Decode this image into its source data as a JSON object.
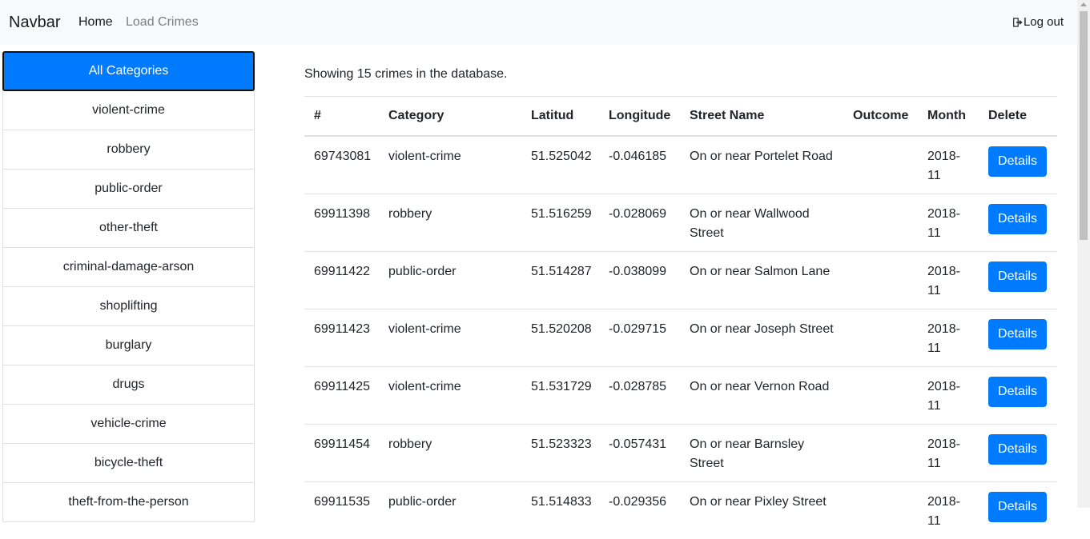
{
  "navbar": {
    "brand": "Navbar",
    "links": [
      "Home",
      "Load Crimes"
    ],
    "logout_label": "Log out",
    "logout_icon": "sign-out-icon"
  },
  "sidebar": {
    "categories": [
      "All Categories",
      "violent-crime",
      "robbery",
      "public-order",
      "other-theft",
      "criminal-damage-arson",
      "shoplifting",
      "burglary",
      "drugs",
      "vehicle-crime",
      "bicycle-theft",
      "theft-from-the-person"
    ],
    "active_index": 0
  },
  "main": {
    "summary": "Showing 15 crimes in the database.",
    "table": {
      "headers": [
        "#",
        "Category",
        "Latitud",
        "Longitude",
        "Street Name",
        "Outcome",
        "Month",
        "Delete"
      ],
      "rows": [
        [
          "69743081",
          "violent-crime",
          "51.525042",
          "-0.046185",
          "On or near Portelet Road",
          "",
          "2018-11"
        ],
        [
          "69911398",
          "robbery",
          "51.516259",
          "-0.028069",
          "On or near Wallwood Street",
          "",
          "2018-11"
        ],
        [
          "69911422",
          "public-order",
          "51.514287",
          "-0.038099",
          "On or near Salmon Lane",
          "",
          "2018-11"
        ],
        [
          "69911423",
          "violent-crime",
          "51.520208",
          "-0.029715",
          "On or near Joseph Street",
          "",
          "2018-11"
        ],
        [
          "69911425",
          "violent-crime",
          "51.531729",
          "-0.028785",
          "On or near Vernon Road",
          "",
          "2018-11"
        ],
        [
          "69911454",
          "robbery",
          "51.523323",
          "-0.057431",
          "On or near Barnsley Street",
          "",
          "2018-11"
        ],
        [
          "69911535",
          "public-order",
          "51.514833",
          "-0.029356",
          "On or near Pixley Street",
          "",
          "2018-11"
        ]
      ],
      "action_label": "Details"
    }
  },
  "colors": {
    "primary": "#007bff",
    "navbar_bg": "#f8f9fa",
    "muted_link": "#7f7f7f"
  }
}
